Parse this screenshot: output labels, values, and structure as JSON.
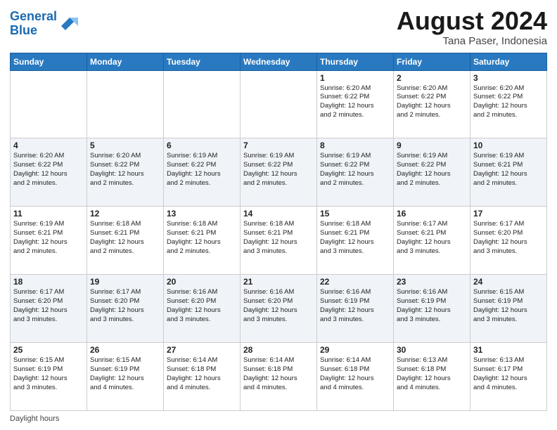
{
  "logo": {
    "line1": "General",
    "line2": "Blue"
  },
  "title": "August 2024",
  "subtitle": "Tana Paser, Indonesia",
  "weekdays": [
    "Sunday",
    "Monday",
    "Tuesday",
    "Wednesday",
    "Thursday",
    "Friday",
    "Saturday"
  ],
  "footer": "Daylight hours",
  "weeks": [
    [
      {
        "num": "",
        "info": ""
      },
      {
        "num": "",
        "info": ""
      },
      {
        "num": "",
        "info": ""
      },
      {
        "num": "",
        "info": ""
      },
      {
        "num": "1",
        "info": "Sunrise: 6:20 AM\nSunset: 6:22 PM\nDaylight: 12 hours\nand 2 minutes."
      },
      {
        "num": "2",
        "info": "Sunrise: 6:20 AM\nSunset: 6:22 PM\nDaylight: 12 hours\nand 2 minutes."
      },
      {
        "num": "3",
        "info": "Sunrise: 6:20 AM\nSunset: 6:22 PM\nDaylight: 12 hours\nand 2 minutes."
      }
    ],
    [
      {
        "num": "4",
        "info": "Sunrise: 6:20 AM\nSunset: 6:22 PM\nDaylight: 12 hours\nand 2 minutes."
      },
      {
        "num": "5",
        "info": "Sunrise: 6:20 AM\nSunset: 6:22 PM\nDaylight: 12 hours\nand 2 minutes."
      },
      {
        "num": "6",
        "info": "Sunrise: 6:19 AM\nSunset: 6:22 PM\nDaylight: 12 hours\nand 2 minutes."
      },
      {
        "num": "7",
        "info": "Sunrise: 6:19 AM\nSunset: 6:22 PM\nDaylight: 12 hours\nand 2 minutes."
      },
      {
        "num": "8",
        "info": "Sunrise: 6:19 AM\nSunset: 6:22 PM\nDaylight: 12 hours\nand 2 minutes."
      },
      {
        "num": "9",
        "info": "Sunrise: 6:19 AM\nSunset: 6:22 PM\nDaylight: 12 hours\nand 2 minutes."
      },
      {
        "num": "10",
        "info": "Sunrise: 6:19 AM\nSunset: 6:21 PM\nDaylight: 12 hours\nand 2 minutes."
      }
    ],
    [
      {
        "num": "11",
        "info": "Sunrise: 6:19 AM\nSunset: 6:21 PM\nDaylight: 12 hours\nand 2 minutes."
      },
      {
        "num": "12",
        "info": "Sunrise: 6:18 AM\nSunset: 6:21 PM\nDaylight: 12 hours\nand 2 minutes."
      },
      {
        "num": "13",
        "info": "Sunrise: 6:18 AM\nSunset: 6:21 PM\nDaylight: 12 hours\nand 2 minutes."
      },
      {
        "num": "14",
        "info": "Sunrise: 6:18 AM\nSunset: 6:21 PM\nDaylight: 12 hours\nand 3 minutes."
      },
      {
        "num": "15",
        "info": "Sunrise: 6:18 AM\nSunset: 6:21 PM\nDaylight: 12 hours\nand 3 minutes."
      },
      {
        "num": "16",
        "info": "Sunrise: 6:17 AM\nSunset: 6:21 PM\nDaylight: 12 hours\nand 3 minutes."
      },
      {
        "num": "17",
        "info": "Sunrise: 6:17 AM\nSunset: 6:20 PM\nDaylight: 12 hours\nand 3 minutes."
      }
    ],
    [
      {
        "num": "18",
        "info": "Sunrise: 6:17 AM\nSunset: 6:20 PM\nDaylight: 12 hours\nand 3 minutes."
      },
      {
        "num": "19",
        "info": "Sunrise: 6:17 AM\nSunset: 6:20 PM\nDaylight: 12 hours\nand 3 minutes."
      },
      {
        "num": "20",
        "info": "Sunrise: 6:16 AM\nSunset: 6:20 PM\nDaylight: 12 hours\nand 3 minutes."
      },
      {
        "num": "21",
        "info": "Sunrise: 6:16 AM\nSunset: 6:20 PM\nDaylight: 12 hours\nand 3 minutes."
      },
      {
        "num": "22",
        "info": "Sunrise: 6:16 AM\nSunset: 6:19 PM\nDaylight: 12 hours\nand 3 minutes."
      },
      {
        "num": "23",
        "info": "Sunrise: 6:16 AM\nSunset: 6:19 PM\nDaylight: 12 hours\nand 3 minutes."
      },
      {
        "num": "24",
        "info": "Sunrise: 6:15 AM\nSunset: 6:19 PM\nDaylight: 12 hours\nand 3 minutes."
      }
    ],
    [
      {
        "num": "25",
        "info": "Sunrise: 6:15 AM\nSunset: 6:19 PM\nDaylight: 12 hours\nand 3 minutes."
      },
      {
        "num": "26",
        "info": "Sunrise: 6:15 AM\nSunset: 6:19 PM\nDaylight: 12 hours\nand 4 minutes."
      },
      {
        "num": "27",
        "info": "Sunrise: 6:14 AM\nSunset: 6:18 PM\nDaylight: 12 hours\nand 4 minutes."
      },
      {
        "num": "28",
        "info": "Sunrise: 6:14 AM\nSunset: 6:18 PM\nDaylight: 12 hours\nand 4 minutes."
      },
      {
        "num": "29",
        "info": "Sunrise: 6:14 AM\nSunset: 6:18 PM\nDaylight: 12 hours\nand 4 minutes."
      },
      {
        "num": "30",
        "info": "Sunrise: 6:13 AM\nSunset: 6:18 PM\nDaylight: 12 hours\nand 4 minutes."
      },
      {
        "num": "31",
        "info": "Sunrise: 6:13 AM\nSunset: 6:17 PM\nDaylight: 12 hours\nand 4 minutes."
      }
    ]
  ]
}
